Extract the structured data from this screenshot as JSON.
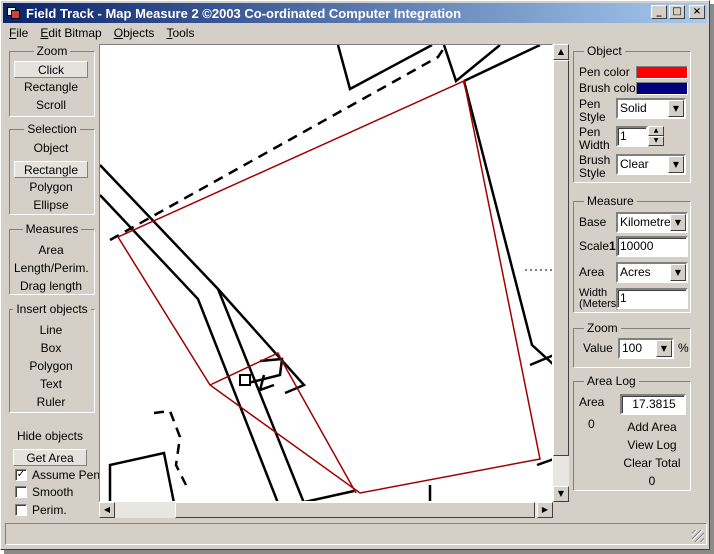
{
  "window": {
    "title": "Field Track - Map Measure 2   ©2003 Co-ordinated Computer Integration",
    "minimize_glyph": "_",
    "maximize_glyph": "□",
    "close_glyph": "×"
  },
  "menu": {
    "file": {
      "u": "F",
      "rest": "ile"
    },
    "edit_bitmap": {
      "u": "E",
      "rest": "dit Bitmap"
    },
    "objects": {
      "u": "O",
      "rest": "bjects"
    },
    "tools": {
      "u": "T",
      "rest": "ools"
    }
  },
  "left": {
    "zoom": {
      "title": "Zoom",
      "click": "Click",
      "rectangle": "Rectangle",
      "scroll": "Scroll"
    },
    "selection": {
      "title": "Selection",
      "object": "Object",
      "rectangle": "Rectangle",
      "polygon": "Polygon",
      "ellipse": "Ellipse"
    },
    "measures": {
      "title": "Measures",
      "area": "Area",
      "length": "Length/Perim.",
      "drag_length": "Drag length"
    },
    "insert": {
      "title": "Insert objects",
      "line": "Line",
      "box": "Box",
      "polygon": "Polygon",
      "text": "Text",
      "ruler": "Ruler"
    },
    "hide_objects": "Hide objects",
    "get_area": "Get Area",
    "assume_pen": {
      "label": "Assume Pen",
      "checked": true,
      "mark": "✓"
    },
    "smooth": {
      "label": "Smooth",
      "checked": false
    },
    "perim": {
      "label": "Perim.",
      "checked": false
    }
  },
  "object_panel": {
    "title": "Object",
    "pen_color_label": "Pen color",
    "pen_color": "#ff0000",
    "brush_color_label": "Brush color",
    "brush_color": "#00007f",
    "pen_style_label": "Pen Style",
    "pen_style_value": "Solid",
    "pen_width_label": "Pen Width",
    "pen_width_value": "1",
    "brush_style_label": "Brush Style",
    "brush_style_value": "Clear"
  },
  "measure_panel": {
    "title": "Measure",
    "base_label": "Base",
    "base_value": "Kilometres",
    "scale_label": "Scale",
    "scale_prefix": "1:",
    "scale_value": "10000",
    "area_label": "Area",
    "area_value": "Acres",
    "width_label": "Width (Meters)",
    "width_value": "1"
  },
  "zoom_panel": {
    "title": "Zoom",
    "value_label": "Value",
    "value": "100",
    "unit": "%"
  },
  "area_log": {
    "title": "Area Log",
    "area_label": "Area",
    "area_value": "17.3815",
    "count": "0",
    "add_area": "Add Area",
    "view_log": "View Log",
    "clear_total": "Clear Total",
    "total": "0"
  },
  "glyphs": {
    "up": "▲",
    "down": "▼",
    "left": "◀",
    "right": "▶"
  },
  "colors": {
    "measure_line": "#a00000",
    "title_start": "#0a246a",
    "title_end": "#a6caf0"
  }
}
